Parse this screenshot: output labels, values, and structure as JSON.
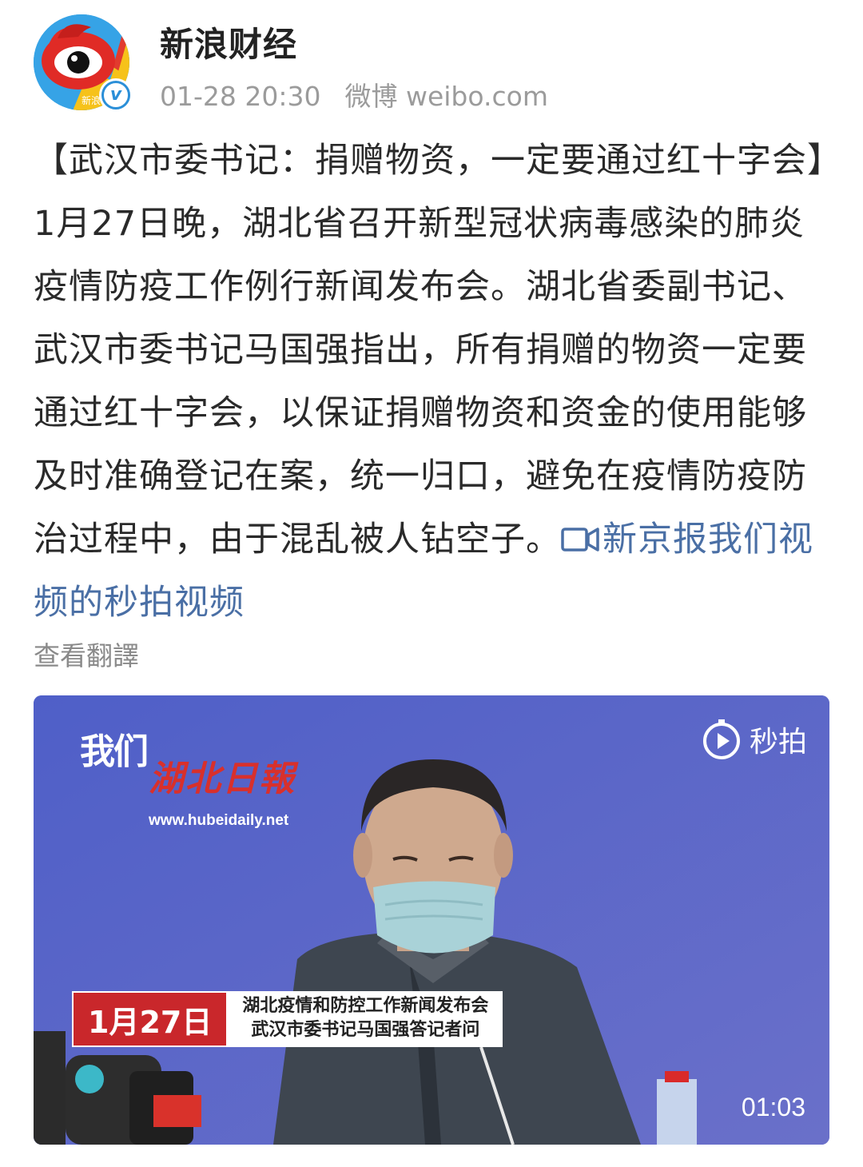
{
  "header": {
    "username": "新浪财经",
    "timestamp": "01-28 20:30",
    "source": "微博 weibo.com",
    "avatar_badge": "新浪",
    "verified_icon": "v"
  },
  "post": {
    "text": "【武汉市委书记：捐赠物资，一定要通过红十字会】1月27日晚，湖北省召开新型冠状病毒感染的肺炎疫情防疫工作例行新闻发布会。湖北省委副书记、武汉市委书记马国强指出，所有捐赠的物资一定要通过红十字会，以保证捐赠物资和资金的使用能够及时准确登记在案，统一归口，避免在疫情防疫防治过程中，由于混乱被人钻空子。",
    "link_label": "新京报我们视频的秒拍视频",
    "link_color": "#4a6fa5"
  },
  "translate_label": "查看翻譯",
  "video": {
    "logo_women": "我们",
    "logo_paper": "湖北日報",
    "logo_url": "www.hubeidaily.net",
    "miaopai_label": "秒拍",
    "caption_date": "1月27日",
    "caption_line1": "湖北疫情和防控工作新闻发布会",
    "caption_line2": "武汉市委书记马国强答记者问",
    "duration": "01:03",
    "background_color": "#5a67c7",
    "caption_color": "#c9272b"
  }
}
